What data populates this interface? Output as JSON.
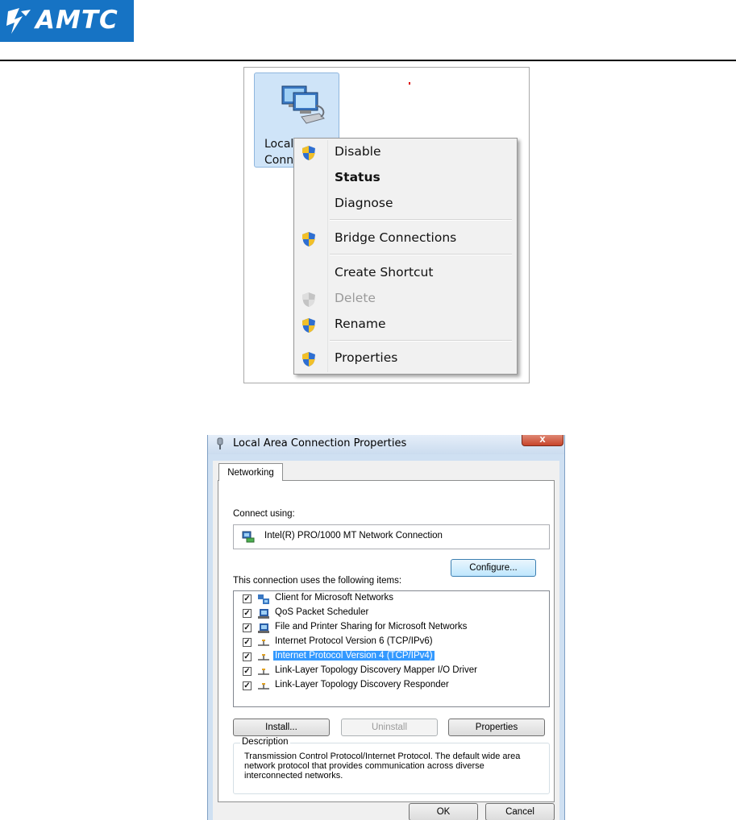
{
  "header": {
    "brand": "AMTC",
    "brand_color": "#1673c4"
  },
  "context_screenshot": {
    "desktop_icon": {
      "label_line1": "Local A",
      "label_line2": "Conn",
      "icon": "network-connection-icon"
    },
    "context_menu": {
      "items": [
        {
          "label": "Disable",
          "icon": "uac-shield-icon",
          "bold": false,
          "enabled": true
        },
        {
          "label": "Status",
          "icon": null,
          "bold": true,
          "enabled": true
        },
        {
          "label": "Diagnose",
          "icon": null,
          "bold": false,
          "enabled": true
        },
        {
          "label": "Bridge Connections",
          "icon": "uac-shield-icon",
          "bold": false,
          "enabled": true
        },
        {
          "label": "Create Shortcut",
          "icon": null,
          "bold": false,
          "enabled": true
        },
        {
          "label": "Delete",
          "icon": "uac-shield-icon",
          "bold": false,
          "enabled": false
        },
        {
          "label": "Rename",
          "icon": "uac-shield-icon",
          "bold": false,
          "enabled": true
        },
        {
          "label": "Properties",
          "icon": "uac-shield-icon",
          "bold": false,
          "enabled": true
        }
      ]
    }
  },
  "dialog": {
    "title": "Local Area Connection Properties",
    "close_label": "x",
    "tab": "Networking",
    "connect_using_label": "Connect using:",
    "adapter": "Intel(R) PRO/1000 MT Network Connection",
    "configure_button": "Configure...",
    "items_label": "This connection uses the following items:",
    "items": [
      {
        "label": "Client for Microsoft Networks",
        "checked": true,
        "selected": false,
        "icon": "network-client-icon"
      },
      {
        "label": "QoS Packet Scheduler",
        "checked": true,
        "selected": false,
        "icon": "network-service-icon"
      },
      {
        "label": "File and Printer Sharing for Microsoft Networks",
        "checked": true,
        "selected": false,
        "icon": "network-service-icon"
      },
      {
        "label": "Internet Protocol Version 6 (TCP/IPv6)",
        "checked": true,
        "selected": false,
        "icon": "protocol-icon"
      },
      {
        "label": "Internet Protocol Version 4 (TCP/IPv4)",
        "checked": true,
        "selected": true,
        "icon": "protocol-icon"
      },
      {
        "label": "Link-Layer Topology Discovery Mapper I/O Driver",
        "checked": true,
        "selected": false,
        "icon": "protocol-icon"
      },
      {
        "label": "Link-Layer Topology Discovery Responder",
        "checked": true,
        "selected": false,
        "icon": "protocol-icon"
      }
    ],
    "install_button": "Install...",
    "uninstall_button": "Uninstall",
    "properties_button": "Properties",
    "description_legend": "Description",
    "description_text": "Transmission Control Protocol/Internet Protocol. The default wide area network protocol that provides communication across diverse interconnected networks.",
    "ok_button": "OK",
    "cancel_button": "Cancel"
  }
}
